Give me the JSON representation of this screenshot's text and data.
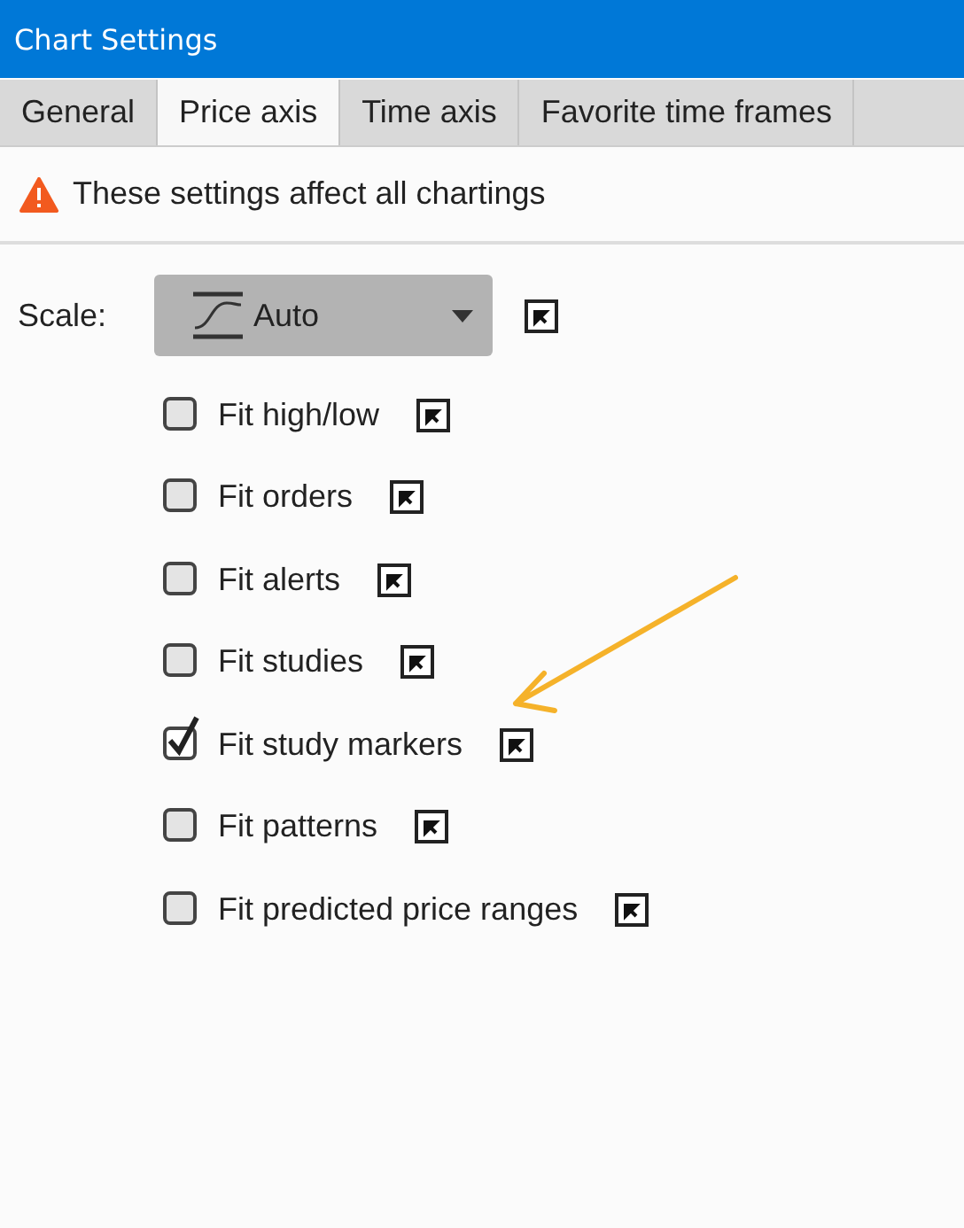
{
  "window": {
    "title": "Chart Settings"
  },
  "tabs": [
    {
      "label": "General",
      "selected": false
    },
    {
      "label": "Price axis",
      "selected": true
    },
    {
      "label": "Time axis",
      "selected": false
    },
    {
      "label": "Favorite time frames",
      "selected": false
    }
  ],
  "notice": {
    "text": "These settings affect all chartings"
  },
  "scale": {
    "label": "Scale:",
    "value": "Auto"
  },
  "options": [
    {
      "label": "Fit high/low",
      "checked": false
    },
    {
      "label": "Fit orders",
      "checked": false
    },
    {
      "label": "Fit alerts",
      "checked": false
    },
    {
      "label": "Fit studies",
      "checked": false
    },
    {
      "label": "Fit study markers",
      "checked": true
    },
    {
      "label": "Fit patterns",
      "checked": false
    },
    {
      "label": "Fit predicted price ranges",
      "checked": false
    }
  ]
}
